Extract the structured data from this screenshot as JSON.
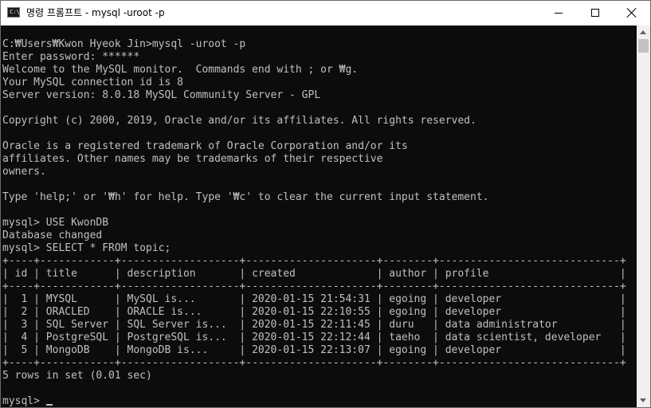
{
  "window": {
    "icon_text": "C:\\",
    "title": "명령 프롬프트 - mysql  -uroot -p"
  },
  "console": {
    "lines": [
      "C:₩Users₩Kwon Hyeok Jin>mysql -uroot -p",
      "Enter password: ******",
      "Welcome to the MySQL monitor.  Commands end with ; or ₩g.",
      "Your MySQL connection id is 8",
      "Server version: 8.0.18 MySQL Community Server - GPL",
      "",
      "Copyright (c) 2000, 2019, Oracle and/or its affiliates. All rights reserved.",
      "",
      "Oracle is a registered trademark of Oracle Corporation and/or its",
      "affiliates. Other names may be trademarks of their respective",
      "owners.",
      "",
      "Type 'help;' or '₩h' for help. Type '₩c' to clear the current input statement.",
      "",
      "mysql> USE KwonDB",
      "Database changed",
      "mysql> SELECT * FROM topic;",
      "+----+------------+-------------------+---------------------+--------+-----------------------------+",
      "| id | title      | description       | created             | author | profile                     |",
      "+----+------------+-------------------+---------------------+--------+-----------------------------+",
      "|  1 | MYSQL      | MySQL is...       | 2020-01-15 21:54:31 | egoing | developer                   |",
      "|  2 | ORACLED    | ORACLE is...      | 2020-01-15 22:10:55 | egoing | developer                   |",
      "|  3 | SQL Server | SQL Server is...  | 2020-01-15 22:11:45 | duru   | data administrator          |",
      "|  4 | PostgreSQL | PostgreSQL is...  | 2020-01-15 22:12:44 | taeho  | data scientist, developer   |",
      "|  5 | MongoDB    | MongoDB is...     | 2020-01-15 22:13:07 | egoing | developer                   |",
      "+----+------------+-------------------+---------------------+--------+-----------------------------+",
      "5 rows in set (0.01 sec)",
      "",
      "mysql> "
    ]
  },
  "colors": {
    "console_background": "#0c0c0c",
    "console_text": "#c0c0c0",
    "titlebar_background": "#ffffff"
  }
}
